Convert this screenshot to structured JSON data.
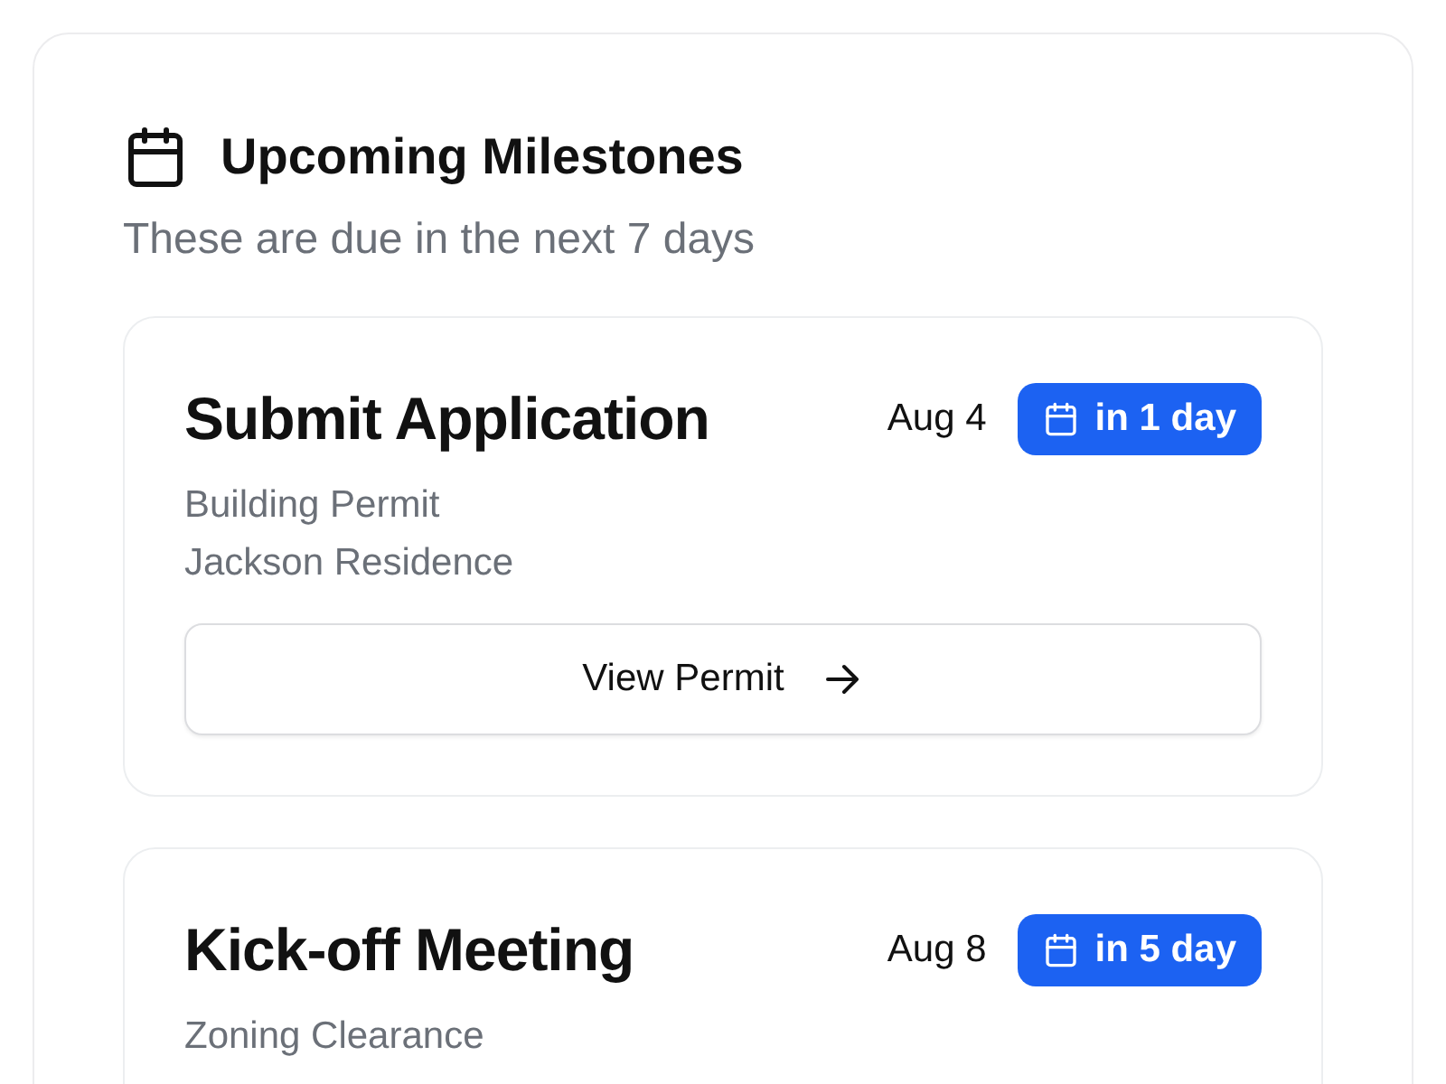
{
  "panel": {
    "title": "Upcoming Milestones",
    "subtitle": "These are due in the next 7 days"
  },
  "milestones": [
    {
      "title": "Submit Application",
      "date": "Aug 4",
      "due": "in 1 day",
      "lines": [
        "Building Permit",
        "Jackson Residence"
      ],
      "action": "View Permit"
    },
    {
      "title": "Kick-off Meeting",
      "date": "Aug 8",
      "due": "in 5 day",
      "lines": [
        "Zoning Clearance"
      ]
    }
  ]
}
